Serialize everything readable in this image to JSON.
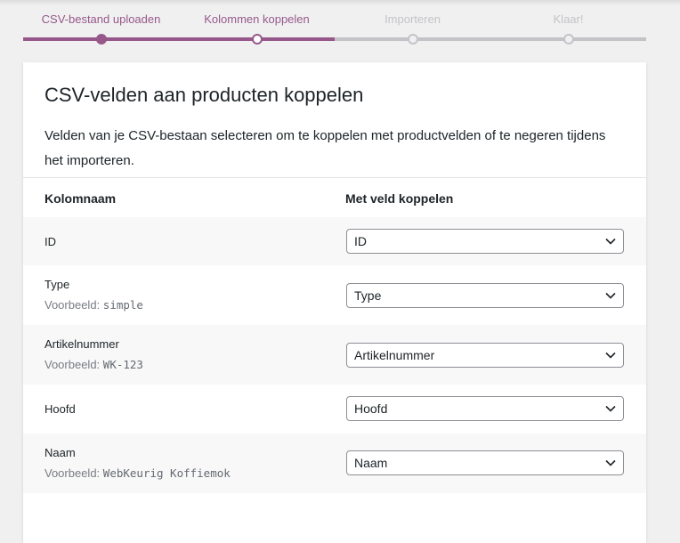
{
  "steps": [
    {
      "label": "CSV-bestand uploaden",
      "state": "done"
    },
    {
      "label": "Kolommen koppelen",
      "state": "active"
    },
    {
      "label": "Importeren",
      "state": "todo"
    },
    {
      "label": "Klaar!",
      "state": "todo"
    }
  ],
  "card": {
    "title": "CSV-velden aan producten koppelen",
    "description": "Velden van je CSV-bestaan selecteren om te koppelen met productvelden of te negeren tijdens het importeren."
  },
  "table": {
    "headers": {
      "column_name": "Kolomnaam",
      "map_to": "Met veld koppelen"
    },
    "sample_prefix": "Voorbeeld:",
    "rows": [
      {
        "name": "ID",
        "sample": "",
        "selected": "ID"
      },
      {
        "name": "Type",
        "sample": "simple",
        "selected": "Type"
      },
      {
        "name": "Artikelnummer",
        "sample": "WK-123",
        "selected": "Artikelnummer"
      },
      {
        "name": "Hoofd",
        "sample": "",
        "selected": "Hoofd"
      },
      {
        "name": "Naam",
        "sample": "WebKeurig Koffiemok",
        "selected": "Naam"
      }
    ]
  },
  "colors": {
    "accent": "#96588a",
    "inactive": "#c3c4c7",
    "background": "#f0f0f1"
  }
}
